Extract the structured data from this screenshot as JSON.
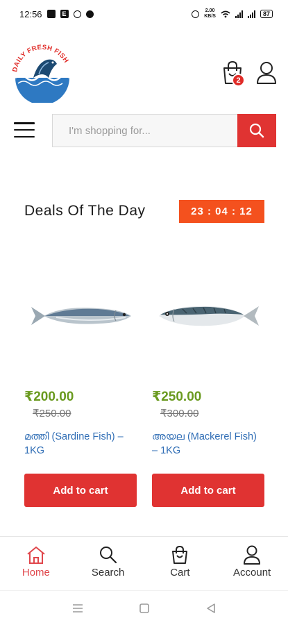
{
  "status_bar": {
    "time": "12:56",
    "net_speed_value": "2.00",
    "net_speed_unit": "KB/S",
    "battery": "87"
  },
  "header": {
    "logo_text": "DAILY FRESH FISH",
    "cart_count": "2"
  },
  "search": {
    "placeholder": "I'm shopping for..."
  },
  "deals": {
    "title": "Deals Of The Day",
    "timer": "23 : 04 : 12"
  },
  "products": [
    {
      "price": "₹200.00",
      "old_price": "₹250.00",
      "name": "മത്തി (Sardine Fish) – 1KG",
      "button": "Add to cart"
    },
    {
      "price": "₹250.00",
      "old_price": "₹300.00",
      "name": "അയല (Mackerel Fish) – 1KG",
      "button": "Add to cart"
    }
  ],
  "bottom_nav": [
    {
      "label": "Home",
      "icon": "home-icon",
      "active": true
    },
    {
      "label": "Search",
      "icon": "search-icon",
      "active": false
    },
    {
      "label": "Cart",
      "icon": "cart-icon",
      "active": false
    },
    {
      "label": "Account",
      "icon": "account-icon",
      "active": false
    }
  ],
  "colors": {
    "accent_red": "#e03332",
    "timer_orange": "#f4511e",
    "price_green": "#6a9a1f",
    "link_blue": "#2f6db5"
  }
}
